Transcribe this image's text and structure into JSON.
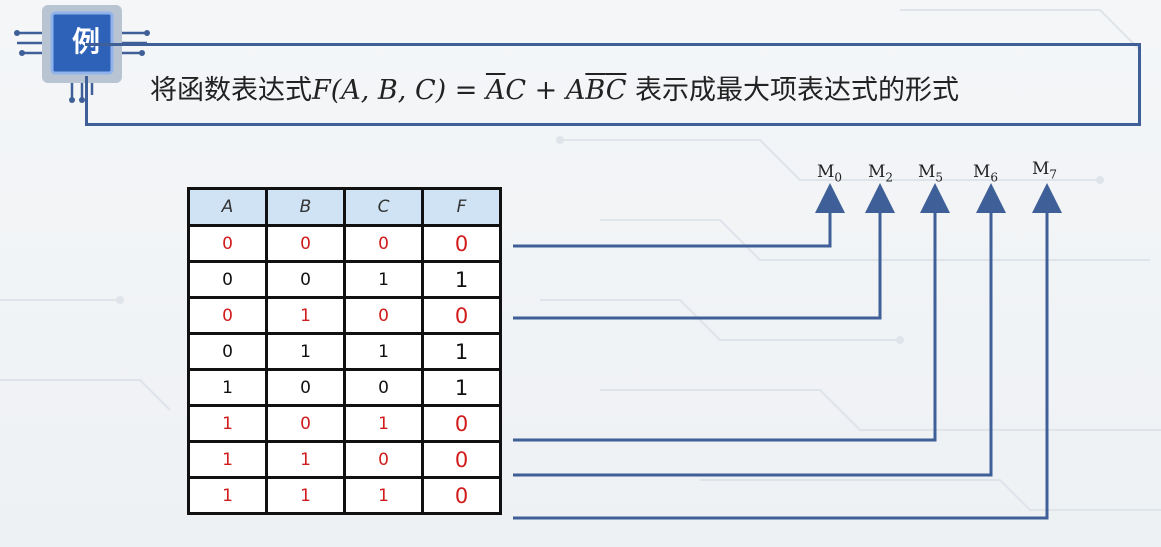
{
  "badge": {
    "label": "例"
  },
  "title": {
    "prefix": "将函数表达式",
    "func": "F(A, B, C) = ",
    "t1a": "A",
    "t1b": "C + A",
    "t2a": "B",
    "t2b": "C",
    "suffix": " 表示成最大项表达式的形式"
  },
  "table": {
    "headers": [
      "A",
      "B",
      "C",
      "F"
    ],
    "rows": [
      {
        "cells": [
          "0",
          "0",
          "0",
          "0"
        ],
        "highlight": true
      },
      {
        "cells": [
          "0",
          "0",
          "1",
          "1"
        ],
        "highlight": false
      },
      {
        "cells": [
          "0",
          "1",
          "0",
          "0"
        ],
        "highlight": true
      },
      {
        "cells": [
          "0",
          "1",
          "1",
          "1"
        ],
        "highlight": false
      },
      {
        "cells": [
          "1",
          "0",
          "0",
          "1"
        ],
        "highlight": false
      },
      {
        "cells": [
          "1",
          "0",
          "1",
          "0"
        ],
        "highlight": true
      },
      {
        "cells": [
          "1",
          "1",
          "0",
          "0"
        ],
        "highlight": true
      },
      {
        "cells": [
          "1",
          "1",
          "1",
          "0"
        ],
        "highlight": true
      }
    ]
  },
  "maxterms": [
    {
      "base": "M",
      "sub": "0"
    },
    {
      "base": "M",
      "sub": "2"
    },
    {
      "base": "M",
      "sub": "5"
    },
    {
      "base": "M",
      "sub": "6"
    },
    {
      "base": "M",
      "sub": "7"
    }
  ],
  "colors": {
    "accent": "#3e5f97",
    "highlight": "#d01c1c",
    "header_bg": "#cfe3f4"
  }
}
